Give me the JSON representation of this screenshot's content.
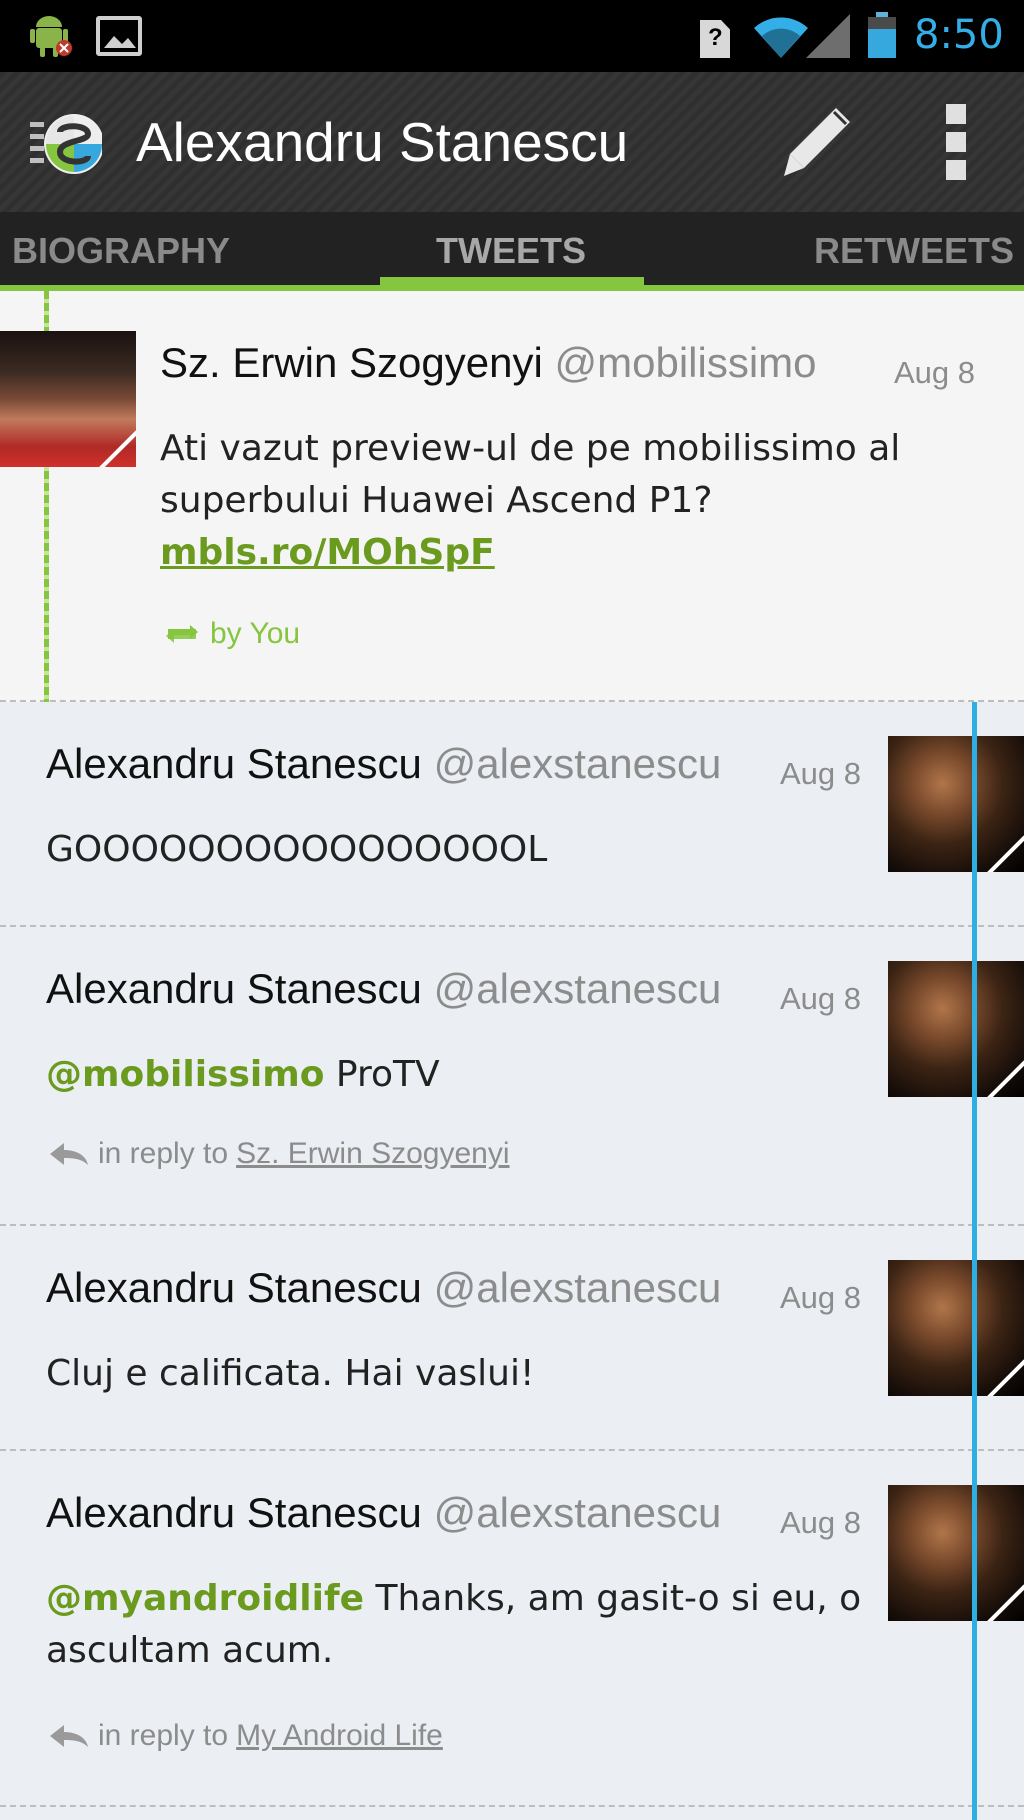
{
  "status_bar": {
    "time": "8:50",
    "battery_level": 0.7,
    "icons": [
      "android-debug-icon",
      "image-notification-icon",
      "sim-alert-icon",
      "wifi-icon",
      "cell-signal-icon",
      "battery-icon"
    ]
  },
  "action_bar": {
    "title": "Alexandru Stanescu",
    "icons": [
      "app-logo-icon",
      "compose-icon",
      "overflow-menu-icon"
    ]
  },
  "tabs": [
    {
      "label": "BIOGRAPHY"
    },
    {
      "label": "TWEETS",
      "selected": true
    },
    {
      "label": "RETWEETS"
    }
  ],
  "colors": {
    "accent_green": "#86c540",
    "accent_blue": "#2faee2",
    "link_green": "#6a9a1e"
  },
  "tweets": [
    {
      "name": "Sz. Erwin Szogyenyi",
      "handle": "@mobilissimo",
      "date": "Aug 8",
      "text": "Ati vazut preview-ul de pe mobilissimo al superbului Huawei Ascend P1?",
      "link": "mbls.ro/MOhSpF",
      "retweet_label": "by You"
    },
    {
      "name": "Alexandru Stanescu",
      "handle": "@alexstanescu",
      "date": "Aug 8",
      "text": "GOOOOOOOOOOOOOOOOL"
    },
    {
      "name": "Alexandru Stanescu",
      "handle": "@alexstanescu",
      "date": "Aug 8",
      "mention": "@mobilissimo",
      "text": " ProTV",
      "reply_label": "in reply to",
      "reply_to": "Sz. Erwin Szogyenyi"
    },
    {
      "name": "Alexandru Stanescu",
      "handle": "@alexstanescu",
      "date": "Aug 8",
      "text": "Cluj e calificata. Hai vaslui!"
    },
    {
      "name": "Alexandru Stanescu",
      "handle": "@alexstanescu",
      "date": "Aug 8",
      "mention": "@myandroidlife",
      "text": " Thanks, am gasit-o si eu, o ascultam acum.",
      "reply_label": "in reply to",
      "reply_to": "My Android Life"
    }
  ]
}
